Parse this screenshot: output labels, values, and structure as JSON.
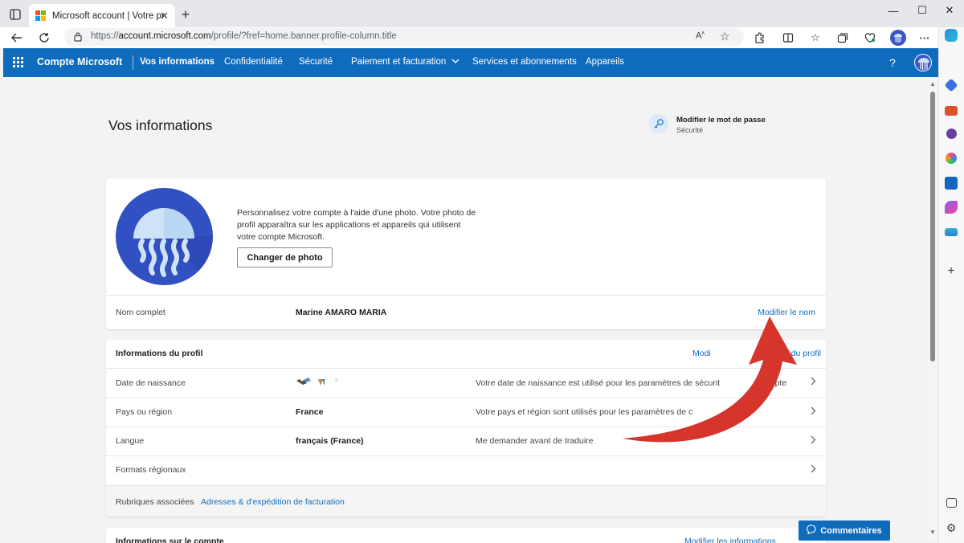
{
  "browser": {
    "tab_title": "Microsoft account | Votre profil",
    "url_prefix": "https://",
    "url_domain": "account.microsoft.com",
    "url_rest": "/profile/?fref=home.banner.profile-column.title"
  },
  "msnav": {
    "brand": "Compte Microsoft",
    "items": [
      "Vos informations",
      "Confidentialité",
      "Sécurité",
      "Paiement et facturation",
      "Services et abonnements",
      "Appareils"
    ],
    "help": "?"
  },
  "page": {
    "title": "Vos informations",
    "password_title": "Modifier le mot de passe",
    "password_sub": "Sécurité"
  },
  "photo": {
    "text": "Personnalisez votre compte à l'aide d'une photo. Votre photo de profil apparaîtra sur les applications et appareils qui utilisent votre compte Microsoft.",
    "button": "Changer de photo"
  },
  "name": {
    "label": "Nom complet",
    "value": "Marine AMARO MARIA",
    "action": "Modifier le nom"
  },
  "profile": {
    "title": "Informations du profil",
    "edit_link_left": "Modi",
    "edit_link_right": "s du profil",
    "rows": [
      {
        "label": "Date de naissance",
        "value": "",
        "desc": "Votre date de naissance est utilisé pour les paramètres de sécurit",
        "desc_tail": "ompte"
      },
      {
        "label": "Pays ou région",
        "value": "France",
        "desc": "Votre pays et région sont utilisés pour les paramètres de c",
        "desc_tail": ""
      },
      {
        "label": "Langue",
        "value": "français (France)",
        "desc": "Me demander avant de traduire",
        "desc_tail": ""
      },
      {
        "label": "Formats régionaux",
        "value": "",
        "desc": "",
        "desc_tail": ""
      }
    ],
    "related_label": "Rubriques associées",
    "related_link": "Adresses & d'expédition de facturation"
  },
  "next_section": {
    "title_partial": "Informations sur le compte",
    "link_partial": "Modifier les informations"
  },
  "feedback": "Commentaires",
  "colors": {
    "accent": "#0f6cbd",
    "arrow": "#d6352b",
    "avatar": "#3150c2"
  }
}
